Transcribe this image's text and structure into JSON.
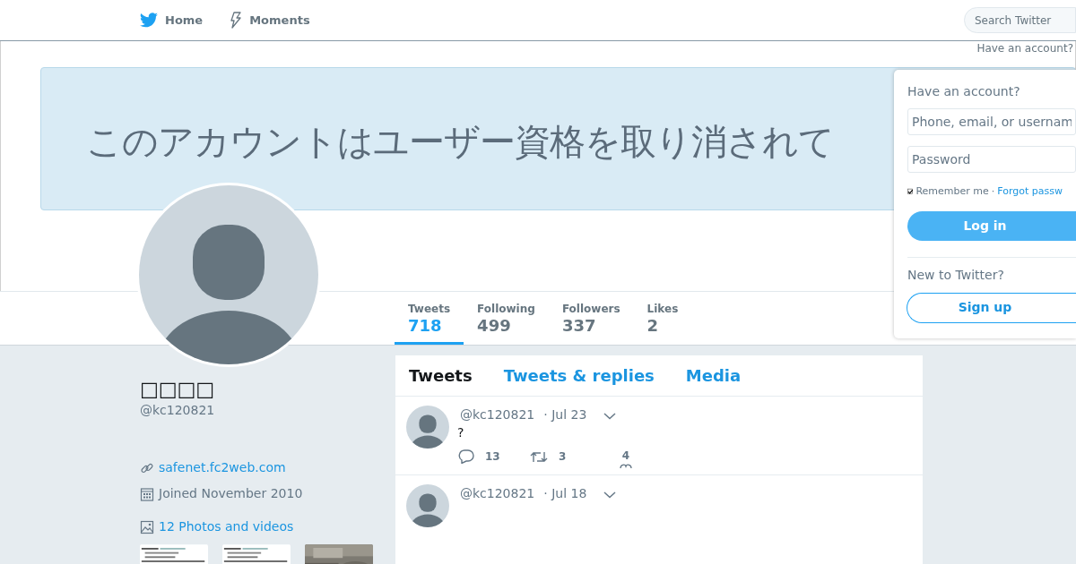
{
  "nav": {
    "items": [
      {
        "kind": "bird",
        "label": "Home"
      },
      {
        "kind": "bolt",
        "label": "Moments"
      }
    ]
  },
  "search": {
    "placeholder": "Search Twitter"
  },
  "top_login_link": "Have an account?",
  "banner": {
    "text": "このアカウントはユーザー資格を取り消されて"
  },
  "profile": {
    "name": "□□□□",
    "handle": "@kc120821",
    "website": "safenet.fc2web.com",
    "joined": "Joined November 2010",
    "media_link": "12 Photos and videos"
  },
  "stats": [
    {
      "label": "Tweets",
      "value": "718",
      "selected": true
    },
    {
      "label": "Following",
      "value": "499",
      "selected": false
    },
    {
      "label": "Followers",
      "value": "337",
      "selected": false
    },
    {
      "label": "Likes",
      "value": "2",
      "selected": false
    }
  ],
  "timeline": {
    "tabs": [
      {
        "label": "Tweets",
        "selected": true
      },
      {
        "label": "Tweets & replies",
        "selected": false
      },
      {
        "label": "Media",
        "selected": false
      }
    ],
    "tweets": [
      {
        "handle": "@kc120821",
        "time": "· Jul 23",
        "text": "?",
        "actions": [
          {
            "kind": "reply",
            "count": "13"
          },
          {
            "kind": "retweet",
            "count": "3"
          },
          {
            "kind": "like",
            "count": "4"
          }
        ]
      },
      {
        "handle": "@kc120821",
        "time": "· Jul 18"
      }
    ]
  },
  "login": {
    "title": "Have an account?",
    "username_placeholder": "Phone, email, or usernam",
    "password_placeholder": "Password",
    "remember": {
      "label": "Remember me",
      "checked": true
    },
    "separator": "·",
    "forgot": "Forgot passw",
    "login_button": "Log in",
    "signup_prompt": "New to Twitter?",
    "signup_button": "Sign up"
  }
}
